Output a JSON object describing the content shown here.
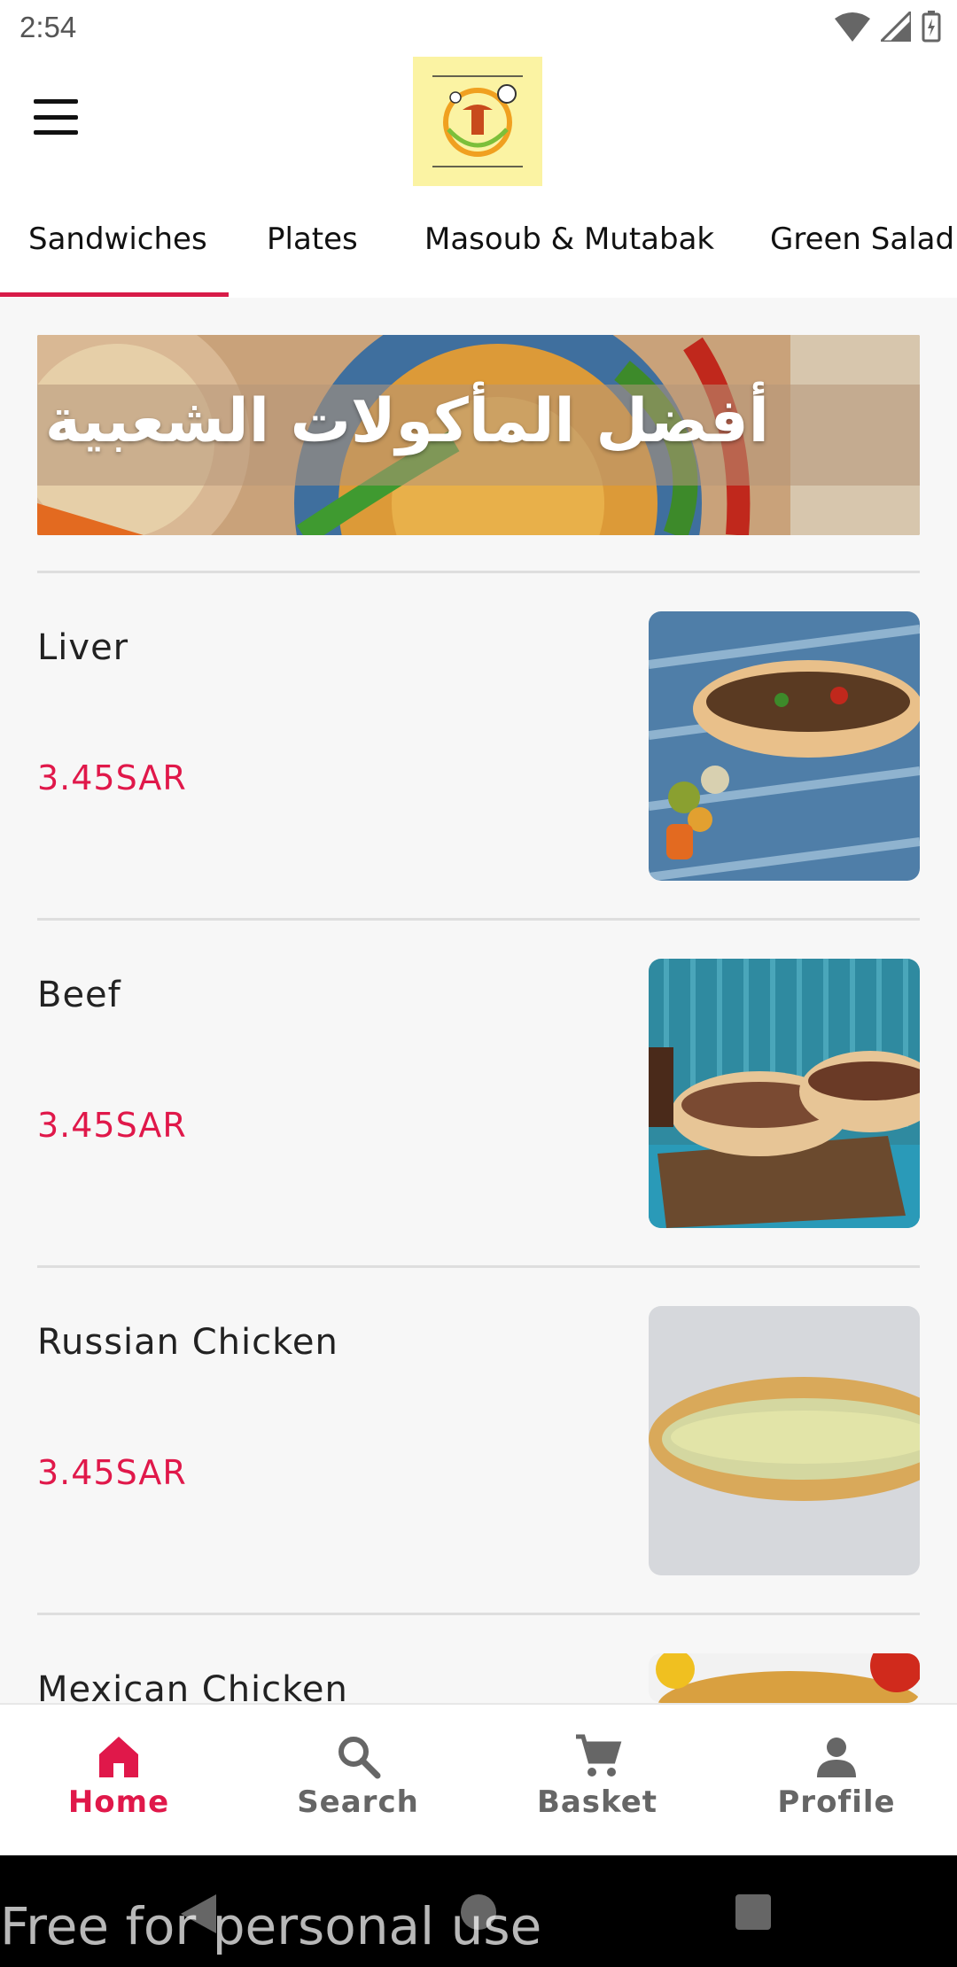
{
  "status_bar": {
    "time": "2:54"
  },
  "logo": {
    "name": "restaurant-logo"
  },
  "tabs": [
    {
      "label": "Sandwiches",
      "active": true
    },
    {
      "label": "Plates",
      "active": false
    },
    {
      "label": "Masoub & Mutabak",
      "active": false
    },
    {
      "label": "Green Salad",
      "active": false
    }
  ],
  "banner": {
    "text": "أفضل المأكولات الشعبية"
  },
  "products": [
    {
      "name": "Liver",
      "price": "3.45SAR"
    },
    {
      "name": "Beef",
      "price": "3.45SAR"
    },
    {
      "name": "Russian Chicken",
      "price": "3.45SAR"
    },
    {
      "name": "Mexican Chicken",
      "price": ""
    }
  ],
  "bottom_nav": [
    {
      "label": "Home",
      "icon": "home-icon",
      "active": true
    },
    {
      "label": "Search",
      "icon": "search-icon",
      "active": false
    },
    {
      "label": "Basket",
      "icon": "cart-icon",
      "active": false
    },
    {
      "label": "Profile",
      "icon": "person-icon",
      "active": false
    }
  ],
  "watermark": "Free for personal use",
  "colors": {
    "accent": "#e0184a",
    "logo_bg": "#fbf3a3",
    "background": "#f7f7f7"
  }
}
